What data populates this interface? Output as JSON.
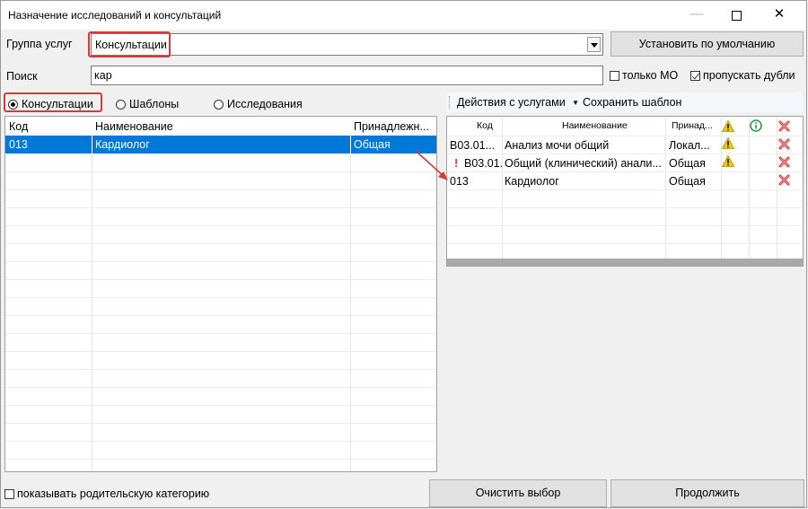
{
  "window": {
    "title": "Назначение исследований и консультаций"
  },
  "group": {
    "label": "Группа услуг",
    "value": "Консультации",
    "default_button": "Установить по умолчанию"
  },
  "search": {
    "label": "Поиск",
    "value": "кар"
  },
  "options": {
    "only_mo": "только МО",
    "skip_duplicates": "пропускать дубли",
    "only_mo_checked": false,
    "skip_duplicates_checked": true
  },
  "tabs": {
    "consultations": "Консультации",
    "templates": "Шаблоны",
    "research": "Исследования",
    "selected": "consultations"
  },
  "left_table": {
    "columns": [
      "Код",
      "Наименование",
      "Принадлежн..."
    ],
    "rows": [
      {
        "code": "013",
        "name": "Кардиолог",
        "belong": "Общая"
      }
    ]
  },
  "right_toolbar": {
    "actions": "Действия с услугами",
    "save_template": "Сохранить шаблон"
  },
  "right_table": {
    "columns": [
      "Код",
      "Наименование",
      "Принад..."
    ],
    "rows": [
      {
        "code": "B03.01...",
        "name": "Анализ мочи общий",
        "belong": "Локал...",
        "warn": true,
        "alert": false
      },
      {
        "code": "B03.01.",
        "name": "Общий (клинический) анали...",
        "belong": "Общая",
        "warn": true,
        "alert": true
      },
      {
        "code": "013",
        "name": "Кардиолог",
        "belong": "Общая",
        "warn": false,
        "alert": false
      }
    ]
  },
  "footer": {
    "show_parent": "показывать родительскую категорию",
    "clear": "Очистить выбор",
    "continue": "Продолжить"
  },
  "colors": {
    "accent": "#0078d7",
    "highlight": "#d9383a",
    "warning": "#f2c811",
    "info": "#1a9c3a"
  }
}
